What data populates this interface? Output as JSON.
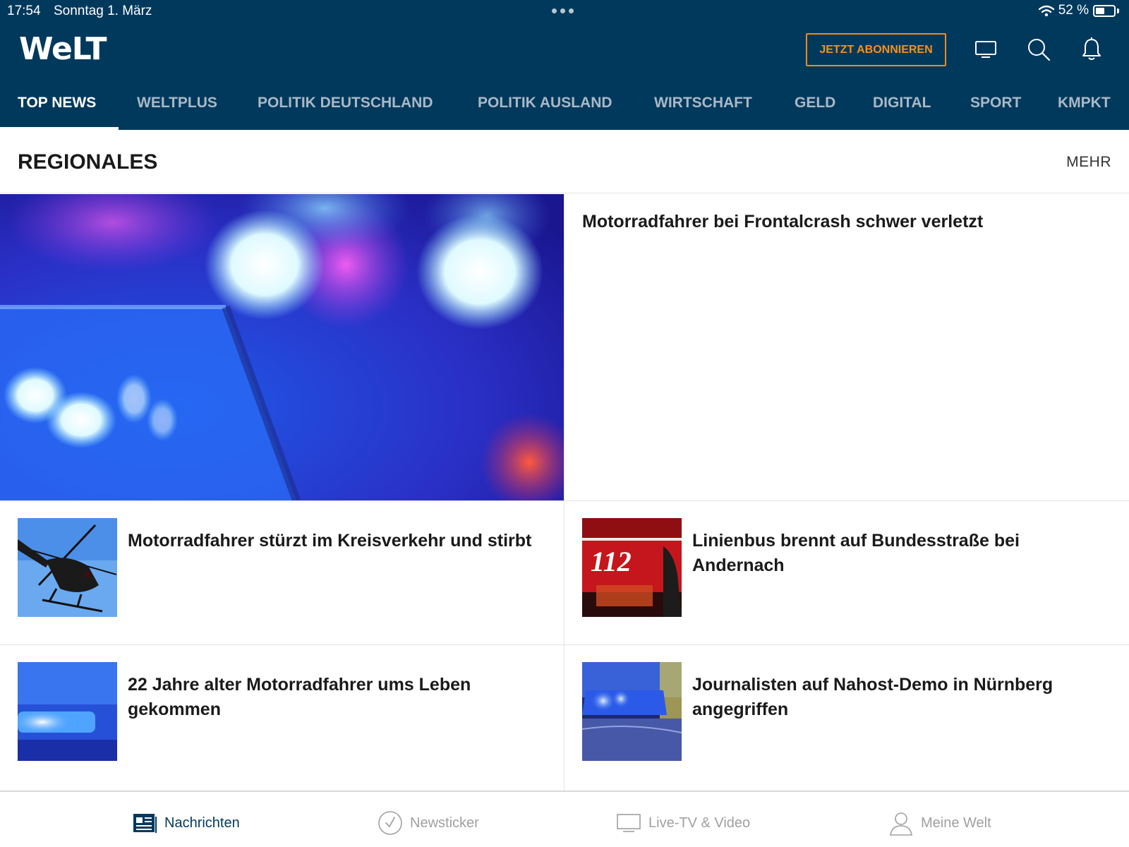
{
  "status_bar": {
    "time": "17:54",
    "date": "Sonntag 1. März",
    "battery": "52 %",
    "battery_level": 0.52
  },
  "header": {
    "logo": "WeLT",
    "subscribe_label": "JETZT ABONNIEREN",
    "icons": [
      "tv-icon",
      "search-icon",
      "bell-icon"
    ],
    "colors": {
      "background": "#01395c",
      "accent": "#f08a1e"
    }
  },
  "nav": {
    "items": [
      "TOP NEWS",
      "WELTPLUS",
      "POLITIK DEUTSCHLAND",
      "POLITIK AUSLAND",
      "WIRTSCHAFT",
      "GELD",
      "DIGITAL",
      "SPORT",
      "KMPKT"
    ],
    "active": "TOP NEWS"
  },
  "section": {
    "title": "REGIONALES",
    "more": "MEHR",
    "hero": {
      "title": "Motorradfahrer bei Frontalcrash schwer verletzt",
      "image": "police-blue-light-photo"
    },
    "articles": [
      {
        "title": "Motorradfahrer stürzt im Kreisverkehr und stirbt",
        "image": "helicopter-photo"
      },
      {
        "title": "Linienbus brennt auf Bundesstraße bei Andernach",
        "image": "fire-truck-112-photo"
      },
      {
        "title": "22 Jahre alter Motorradfahrer ums Leben gekommen",
        "image": "blue-light-photo"
      },
      {
        "title": "Journalisten auf Nahost-Demo in Nürnberg angegriffen",
        "image": "police-car-photo"
      }
    ]
  },
  "tabbar": {
    "tabs": [
      {
        "label": "Nachrichten",
        "icon": "newspaper-icon"
      },
      {
        "label": "Newsticker",
        "icon": "clock-icon"
      },
      {
        "label": "Live-TV & Video",
        "icon": "tv-icon"
      },
      {
        "label": "Meine Welt",
        "icon": "user-icon"
      }
    ],
    "active": "Nachrichten"
  }
}
